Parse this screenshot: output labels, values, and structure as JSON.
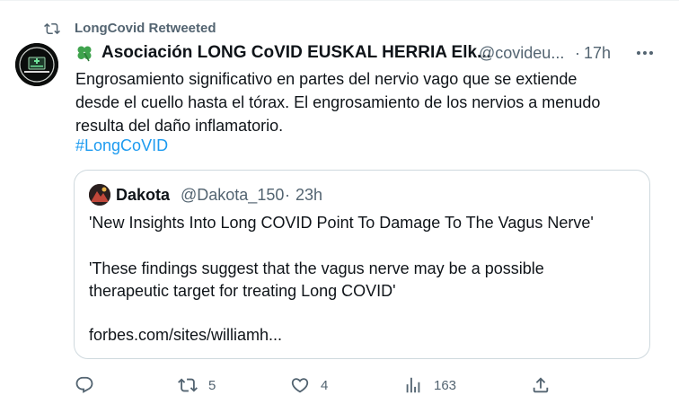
{
  "retweet": {
    "icon": "retweet-icon",
    "label": "LongCovid Retweeted"
  },
  "tweet": {
    "avatar_icon": "avatar-long-covid-logo",
    "name_emoji_icon": "four-leaf-clover-icon",
    "display_name": "Asociación LONG CoVID EUSKAL HERRIA Elk...",
    "handle": "@covideu...",
    "separator": "·",
    "time": "17h",
    "more_icon": "more-icon",
    "text_lines": [
      "Engrosamiento significativo en partes del nervio vago que se extiende",
      "desde el cuello hasta el tórax. El engrosamiento de los nervios a menudo",
      "resulta del daño inflamatorio."
    ],
    "hashtag": "#LongCoVID",
    "hashtag_color": "#1d9bf0"
  },
  "quote": {
    "avatar_icon": "avatar-dakota",
    "name": "Dakota",
    "handle": "@Dakota_150",
    "separator": "·",
    "time": "23h",
    "line1": "'New Insights Into Long COVID Point To Damage To The Vagus Nerve'",
    "line2": "'These findings suggest that the vagus nerve may be a possible",
    "line3": "therapeutic target for treating Long COVID'",
    "link": "forbes.com/sites/williamh..."
  },
  "actions": {
    "reply_icon": "reply-icon",
    "retweet_icon": "retweet-icon",
    "retweets": "5",
    "like_icon": "heart-icon",
    "likes": "4",
    "views_icon": "analytics-icon",
    "views": "163",
    "share_icon": "share-icon"
  },
  "colors": {
    "secondary_text": "#536471",
    "border": "#cfd9de",
    "text": "#0f1419",
    "accent": "#1d9bf0"
  }
}
